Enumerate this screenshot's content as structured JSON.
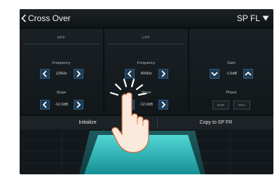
{
  "header": {
    "title": "Cross Over",
    "channel": "SP FL"
  },
  "hpf": {
    "title": "HPF",
    "frequency_label": "Frequency",
    "frequency_value": "125Hz",
    "slope_label": "Slope",
    "slope_value": "-12.0dB"
  },
  "lpf": {
    "title": "LPF",
    "frequency_label": "Frequency",
    "frequency_value": "400Hz",
    "slope_label": "Slope",
    "slope_value": "-12.0dB"
  },
  "gain_panel": {
    "gain_label": "Gain",
    "gain_value": "-1.5dB",
    "phase_label": "Phase",
    "phase_normal": "NOR",
    "phase_reverse": "REV"
  },
  "actions": {
    "initialize": "Initialize",
    "copy": "Copy to SP FR"
  },
  "icons": [
    "back-chevron-icon",
    "dropdown-triangle-icon",
    "left-arrow-icon",
    "right-arrow-icon",
    "down-arrow-icon",
    "up-arrow-icon",
    "pointing-hand-icon"
  ],
  "colors": {
    "accent": "#2fc3c4",
    "arrow_button": "#1d3b55",
    "background": "#0b1013"
  }
}
